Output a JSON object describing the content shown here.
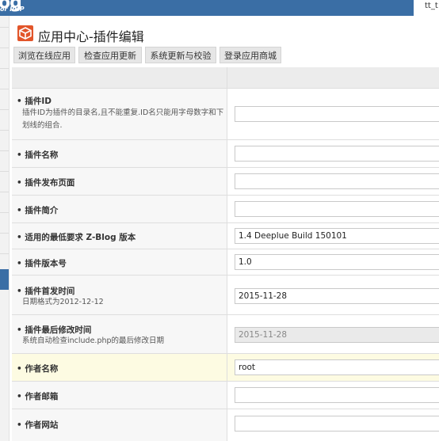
{
  "header": {
    "logo": "og",
    "logo_sub": "or PHP",
    "user": "tt_t"
  },
  "title": "应用中心-插件编辑",
  "tabs": [
    "浏览在线应用",
    "检查应用更新",
    "系统更新与校验",
    "登录应用商城"
  ],
  "fields": [
    {
      "label": "• 插件ID",
      "desc": "插件ID为插件的目录名,且不能重复.ID名只能用字母数字和下划线的组合.",
      "value": ""
    },
    {
      "label": "• 插件名称",
      "value": ""
    },
    {
      "label": "• 插件发布页面",
      "value": ""
    },
    {
      "label": "• 插件简介",
      "value": ""
    },
    {
      "label": "• 适用的最低要求 Z-Blog 版本",
      "value": "1.4 Deeplue Build 150101"
    },
    {
      "label": "• 插件版本号",
      "value": "1.0"
    },
    {
      "label": "• 插件首发时间",
      "desc": "日期格式为2012-12-12",
      "value": "2015-11-28"
    },
    {
      "label": "• 插件最后修改时间",
      "desc": "系统自动检查include.php的最后修改日期",
      "value": "2015-11-28",
      "readonly": true
    },
    {
      "label": "• 作者名称",
      "value": "root"
    },
    {
      "label": "• 作者邮箱",
      "value": ""
    },
    {
      "label": "• 作者网站",
      "value": ""
    }
  ],
  "colors": {
    "header_bg": "#3a6ea5",
    "title_icon": "#e2552a",
    "highlight_row": "#fdfbe2"
  }
}
